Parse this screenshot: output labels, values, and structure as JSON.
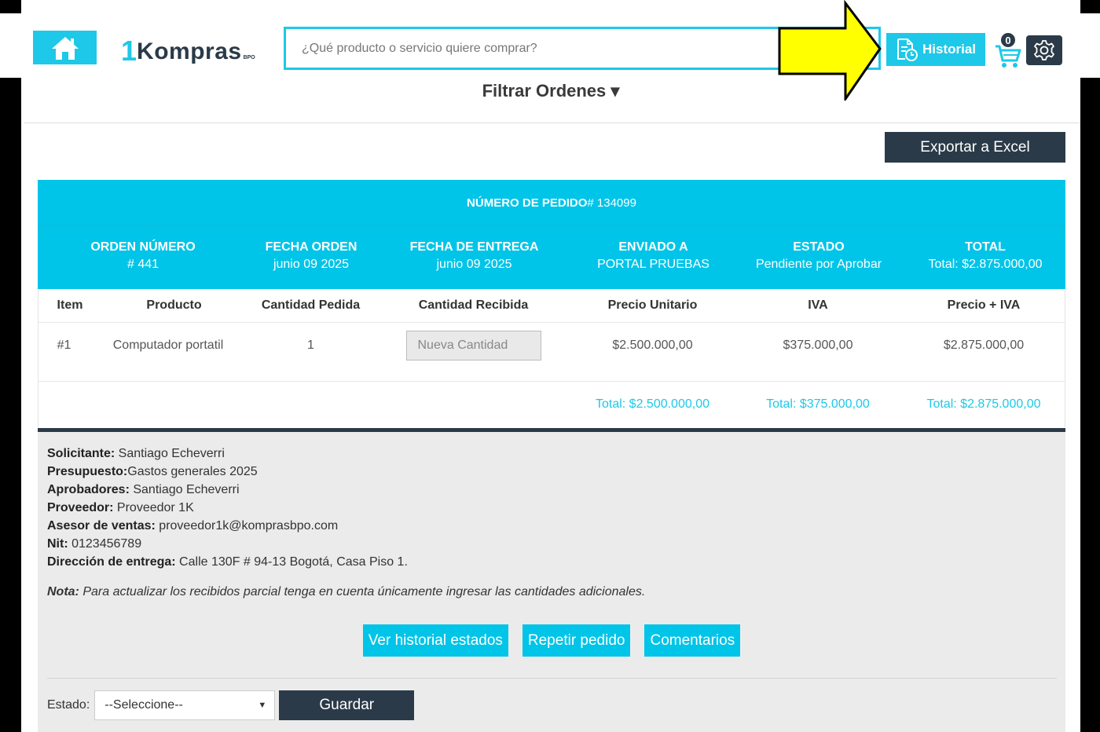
{
  "header": {
    "logo_one": "1",
    "logo_text": "Kompras",
    "logo_suffix": "BPO",
    "search_placeholder": "¿Qué producto o servicio quiere comprar?",
    "history_label": "Historial",
    "cart_count": "0"
  },
  "filter_label": "Filtrar Ordenes ▾",
  "export_label": "Exportar a Excel",
  "order": {
    "pedido_label": "NÚMERO DE PEDIDO",
    "pedido_value": "# 134099",
    "meta": [
      {
        "label": "ORDEN NÚMERO",
        "value": "# 441"
      },
      {
        "label": "FECHA ORDEN",
        "value": "junio 09 2025"
      },
      {
        "label": "FECHA DE ENTREGA",
        "value": "junio 09 2025"
      },
      {
        "label": "ENVIADO A",
        "value": "PORTAL PRUEBAS"
      },
      {
        "label": "ESTADO",
        "value": "Pendiente por Aprobar"
      },
      {
        "label": "TOTAL",
        "value": "Total: $2.875.000,00"
      }
    ],
    "columns": [
      "Item",
      "Producto",
      "Cantidad Pedida",
      "Cantidad Recibida",
      "Precio Unitario",
      "IVA",
      "Precio + IVA"
    ],
    "rows": [
      {
        "item": "#1",
        "producto": "Computador portatil",
        "cantidad": "1",
        "recibida_placeholder": "Nueva Cantidad",
        "precio": "$2.500.000,00",
        "iva": "$375.000,00",
        "total": "$2.875.000,00"
      }
    ],
    "totals": {
      "precio": "Total: $2.500.000,00",
      "iva": "Total: $375.000,00",
      "total": "Total: $2.875.000,00"
    }
  },
  "info": {
    "solicitante_label": "Solicitante:",
    "solicitante": " Santiago Echeverri",
    "presupuesto_label": "Presupuesto:",
    "presupuesto": "Gastos generales 2025",
    "aprobadores_label": "Aprobadores:",
    "aprobadores": " Santiago Echeverri",
    "proveedor_label": "Proveedor:",
    "proveedor": " Proveedor 1K",
    "asesor_label": "Asesor de ventas:",
    "asesor": " proveedor1k@komprasbpo.com",
    "nit_label": "Nit:",
    "nit": " 0123456789",
    "direccion_label": "Dirección de entrega:",
    "direccion": " Calle 130F # 94-13 Bogotá, Casa Piso 1.",
    "nota_label": "Nota:",
    "nota": " Para actualizar los recibidos parcial tenga en cuenta únicamente ingresar las cantidades adicionales."
  },
  "actions": {
    "historial": "Ver historial estados",
    "repetir": "Repetir pedido",
    "comentarios": "Comentarios"
  },
  "estado": {
    "label": "Estado:",
    "selected": "--Seleccione--",
    "save": "Guardar"
  },
  "colors": {
    "accent": "#00c4e8",
    "dark": "#2a3a48",
    "arrow": "#ffff00"
  }
}
